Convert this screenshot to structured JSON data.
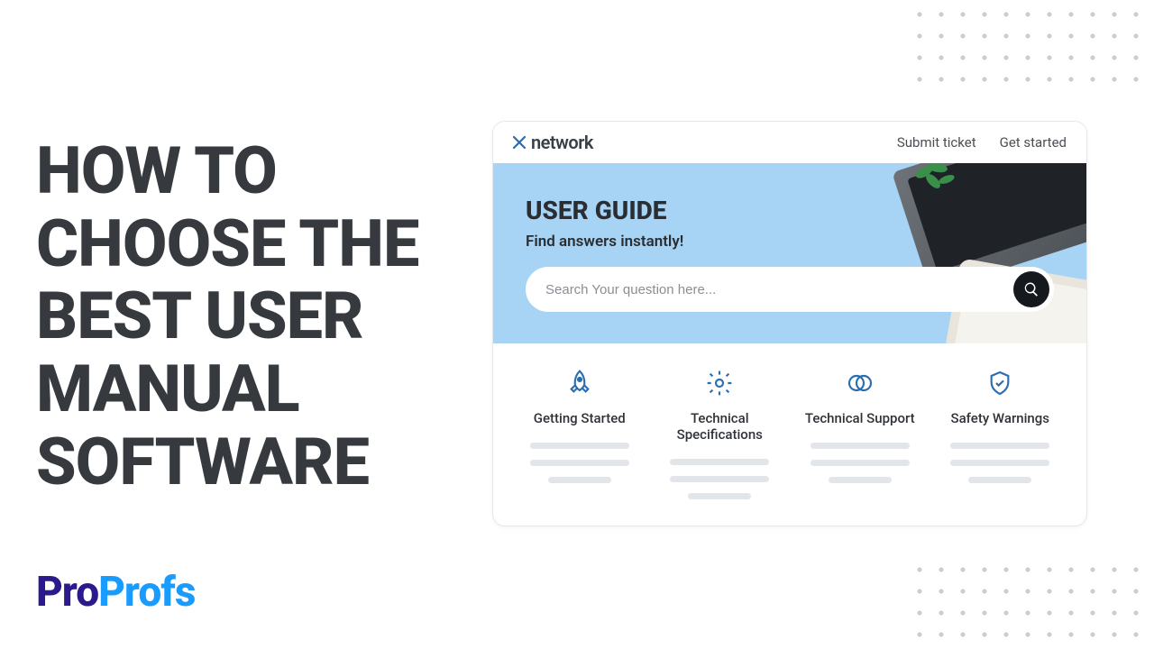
{
  "headline": "HOW TO CHOOSE THE BEST USER MANUAL SOFTWARE",
  "logo": {
    "part1": "Pro",
    "part2": "Profs"
  },
  "card": {
    "brand": "network",
    "links": {
      "submit": "Submit ticket",
      "start": "Get started"
    },
    "hero": {
      "title": "USER GUIDE",
      "subtitle": "Find answers instantly!",
      "search_placeholder": "Search Your question here..."
    },
    "categories": [
      {
        "icon": "rocket",
        "label": "Getting Started"
      },
      {
        "icon": "gear",
        "label": "Technical Specifications"
      },
      {
        "icon": "circles",
        "label": "Technical Support"
      },
      {
        "icon": "shield",
        "label": "Safety Warnings"
      }
    ]
  }
}
